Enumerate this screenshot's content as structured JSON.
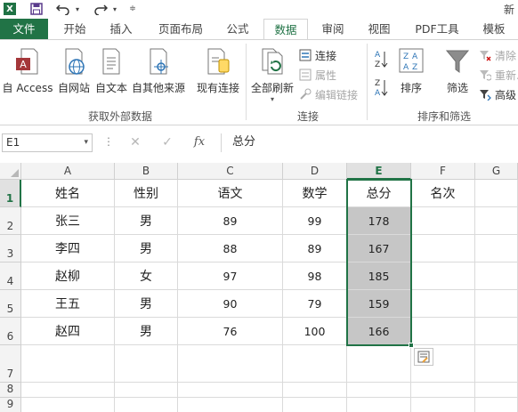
{
  "titlebar": {
    "app_logo": "X",
    "title_fragment": "新"
  },
  "icons": {
    "save": "save-icon",
    "undo": "undo-icon",
    "redo": "redo-icon"
  },
  "tabs": [
    {
      "label": "文件"
    },
    {
      "label": "开始"
    },
    {
      "label": "插入"
    },
    {
      "label": "页面布局"
    },
    {
      "label": "公式"
    },
    {
      "label": "数据"
    },
    {
      "label": "审阅"
    },
    {
      "label": "视图"
    },
    {
      "label": "PDF工具"
    },
    {
      "label": "模板"
    }
  ],
  "ribbon": {
    "get_external": {
      "access": "自 Access",
      "web": "自网站",
      "text": "自文本",
      "other": "自其他来源",
      "existing": "现有连接",
      "group_label": "获取外部数据"
    },
    "connections": {
      "refresh_all": "全部刷新",
      "connections": "连接",
      "properties": "属性",
      "edit_links": "编辑链接",
      "group_label": "连接"
    },
    "sort_filter": {
      "sort": "排序",
      "filter": "筛选",
      "clear": "清除",
      "reapply": "重新...",
      "advanced": "高级",
      "group_label": "排序和筛选"
    }
  },
  "formula_bar": {
    "name_box": "E1",
    "cancel": "✕",
    "enter": "✓",
    "fx": "fx",
    "content": "总分"
  },
  "sheet": {
    "columns": [
      "A",
      "B",
      "C",
      "D",
      "E",
      "F",
      "G"
    ],
    "rows": [
      "1",
      "2",
      "3",
      "4",
      "5",
      "6",
      "7",
      "8",
      "9"
    ],
    "headers": [
      "姓名",
      "性别",
      "语文",
      "数学",
      "总分",
      "名次"
    ],
    "data": [
      [
        "张三",
        "男",
        "89",
        "99",
        "178"
      ],
      [
        "李四",
        "男",
        "88",
        "89",
        "167"
      ],
      [
        "赵柳",
        "女",
        "97",
        "98",
        "185"
      ],
      [
        "王五",
        "男",
        "90",
        "79",
        "159"
      ],
      [
        "赵四",
        "男",
        "76",
        "100",
        "166"
      ]
    ]
  }
}
